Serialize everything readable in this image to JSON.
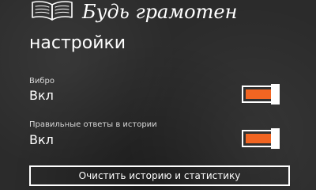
{
  "header": {
    "logo_icon": "open-book-icon",
    "app_title": "Будь грамотен"
  },
  "page": {
    "title": "настройки"
  },
  "settings": [
    {
      "label": "Вибро",
      "value": "Вкл",
      "enabled": true
    },
    {
      "label": "Правильные ответы в истории",
      "value": "Вкл",
      "enabled": true
    }
  ],
  "actions": {
    "clear_label": "Очистить историю и статистику"
  },
  "colors": {
    "background": "#2b2b2b",
    "accent": "#f26522",
    "foreground": "#ffffff"
  }
}
